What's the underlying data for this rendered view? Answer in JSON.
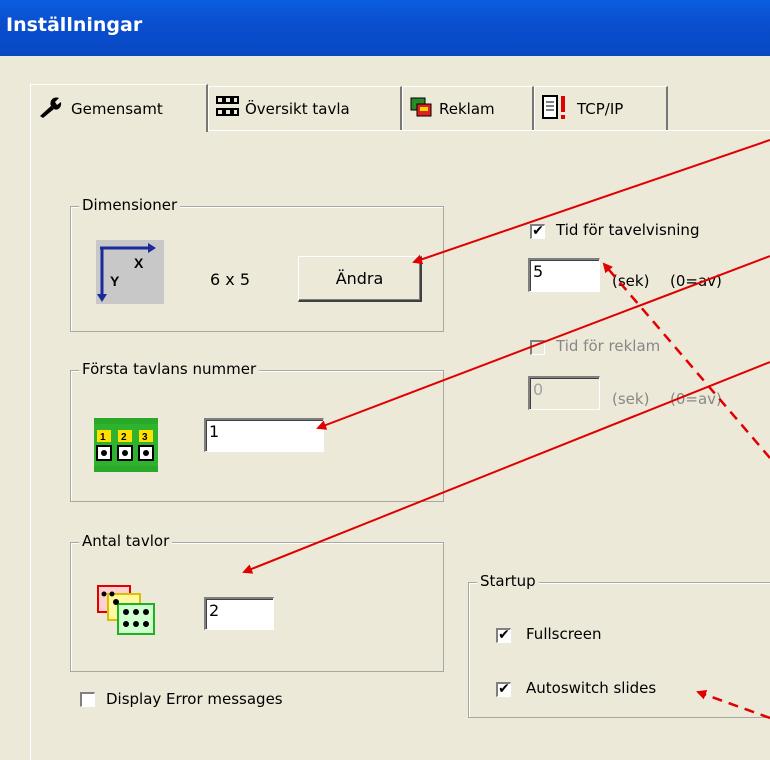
{
  "window": {
    "title": "Inställningar"
  },
  "tabs": [
    {
      "label": "Gemensamt",
      "icon": "wrench-icon"
    },
    {
      "label": "Översikt tavla",
      "icon": "grid-icon"
    },
    {
      "label": "Reklam",
      "icon": "ad-icon"
    },
    {
      "label": "TCP/IP",
      "icon": "network-icon"
    }
  ],
  "dimensioner": {
    "legend": "Dimensioner",
    "icon": "xy-axes-icon",
    "axis_x": "X",
    "axis_y": "Y",
    "value": "6 x 5",
    "button": "Ändra"
  },
  "forsta": {
    "legend": "Första tavlans nummer",
    "icon": "numbered-boards-icon",
    "value": "1",
    "digits": [
      "1",
      "2",
      "3"
    ]
  },
  "antal": {
    "legend": "Antal tavlor",
    "icon": "stacked-boards-icon",
    "value": "2"
  },
  "display_errors": {
    "label": "Display Error messages",
    "checked": false
  },
  "tid_tavel": {
    "label": "Tid för tavelvisning",
    "checked": true,
    "value": "5",
    "unit": "(sek)",
    "hint": "(0=av)"
  },
  "tid_reklam": {
    "label": "Tid för reklam",
    "checked": false,
    "value": "0",
    "unit": "(sek)",
    "hint": "(0=av)"
  },
  "startup": {
    "legend": "Startup",
    "fullscreen": {
      "label": "Fullscreen",
      "checked": true
    },
    "autoswitch": {
      "label": "Autoswitch slides",
      "checked": true
    }
  },
  "colors": {
    "arrow": "#e00000",
    "title_bg": "#0a4fd0"
  }
}
